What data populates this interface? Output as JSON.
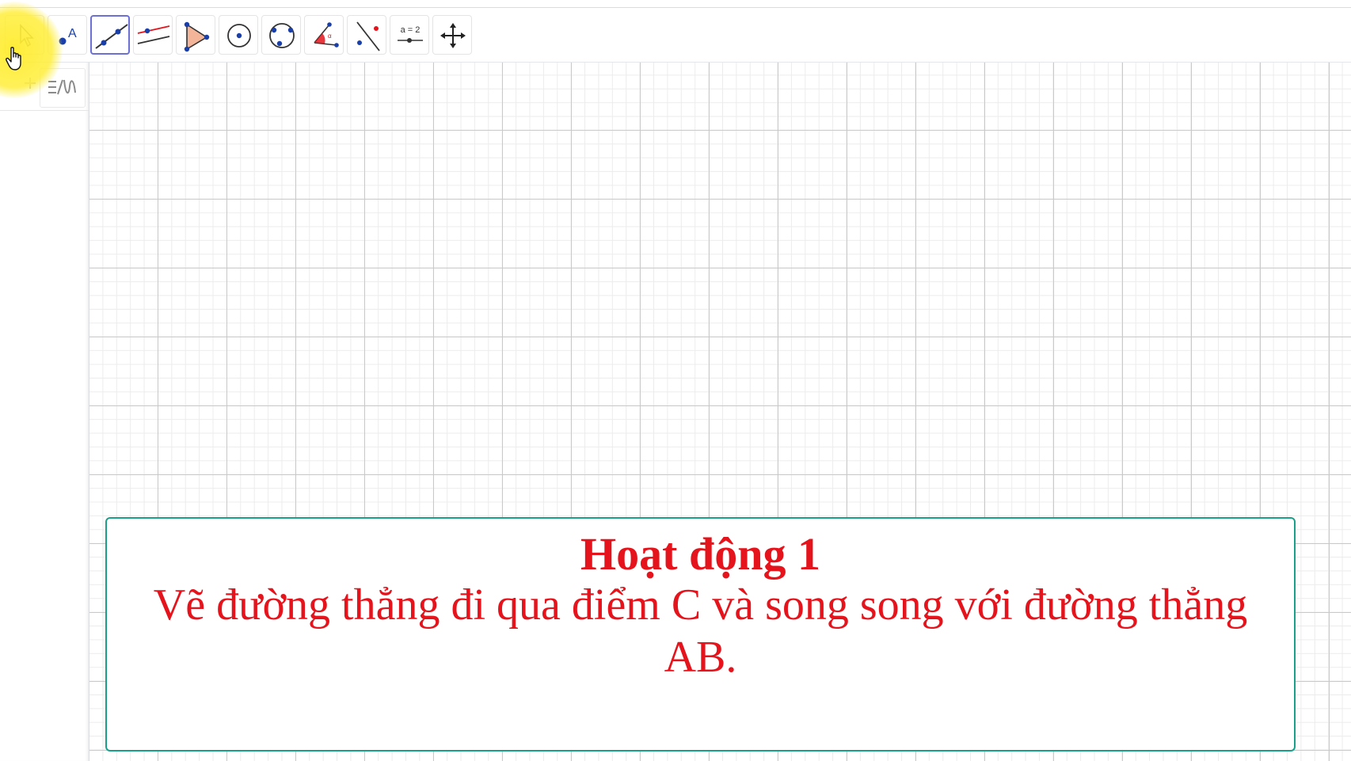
{
  "toolbar": {
    "tools": [
      {
        "icon": "move-arrow-icon",
        "state": "normal"
      },
      {
        "icon": "point-icon",
        "label": "A",
        "state": "normal"
      },
      {
        "icon": "line-icon",
        "state": "selected"
      },
      {
        "icon": "perpendicular-line-icon",
        "state": "normal"
      },
      {
        "icon": "polygon-icon",
        "state": "normal"
      },
      {
        "icon": "circle-center-icon",
        "state": "normal"
      },
      {
        "icon": "circle-three-points-icon",
        "state": "normal"
      },
      {
        "icon": "angle-icon",
        "state": "normal"
      },
      {
        "icon": "reflect-line-icon",
        "state": "normal"
      },
      {
        "icon": "slider-icon",
        "label": "a = 2",
        "state": "normal"
      },
      {
        "icon": "move-graphics-view-icon",
        "state": "normal"
      }
    ]
  },
  "algebra": {
    "plus_icon": "plus-icon",
    "keyboard_icon": "keyboard-icon"
  },
  "activity": {
    "title": "Hoạt động 1",
    "text": "Vẽ đường thẳng đi qua điểm C và song song với đường thẳng AB."
  },
  "colors": {
    "activity_text": "#e5141c",
    "activity_border": "#1aa08a",
    "selected_tool_border": "#6b6fd6",
    "point_blue": "#1a3fa8",
    "cursor_highlight": "#ffeb28"
  }
}
